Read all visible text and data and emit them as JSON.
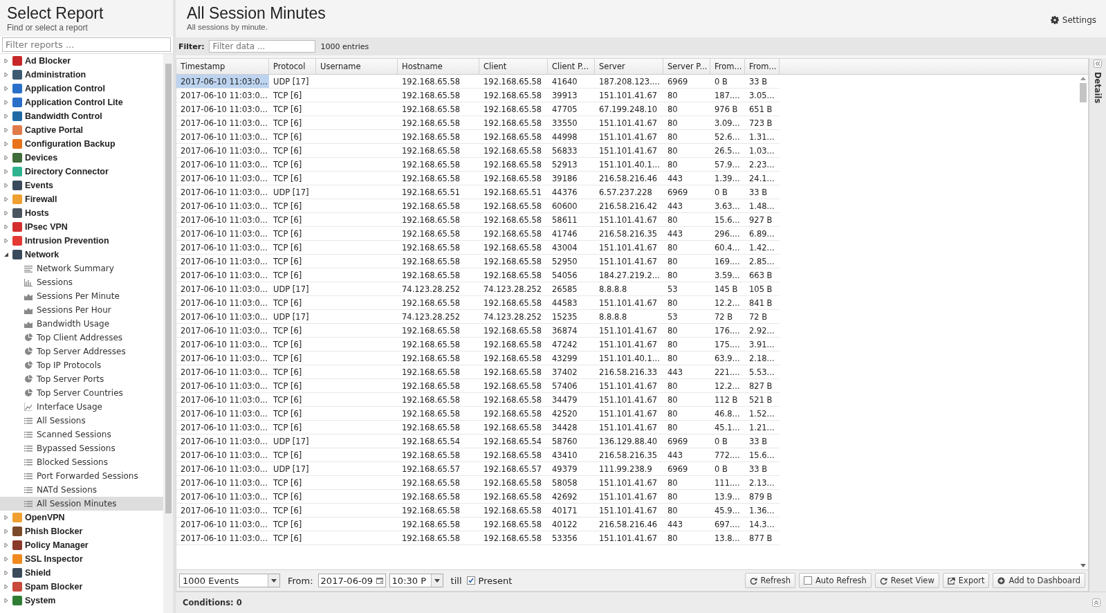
{
  "sidebar": {
    "title": "Select Report",
    "subtitle": "Find or select a report",
    "search": {
      "placeholder": "Filter reports ..."
    },
    "items": [
      {
        "label": "Ad Blocker",
        "color": "#c62828",
        "expanded": false
      },
      {
        "label": "Administration",
        "color": "#3d5a73",
        "expanded": false
      },
      {
        "label": "Application Control",
        "color": "#2a6fc9",
        "expanded": false
      },
      {
        "label": "Application Control Lite",
        "color": "#2a6fc8",
        "expanded": false
      },
      {
        "label": "Bandwidth Control",
        "color": "#1f6aa5",
        "expanded": false
      },
      {
        "label": "Captive Portal",
        "color": "#e07b4a",
        "expanded": false
      },
      {
        "label": "Configuration Backup",
        "color": "#e8731a",
        "expanded": false
      },
      {
        "label": "Devices",
        "color": "#3f6d3a",
        "expanded": false
      },
      {
        "label": "Directory Connector",
        "color": "#2fb38e",
        "expanded": false
      },
      {
        "label": "Events",
        "color": "#3a4a5c",
        "expanded": false
      },
      {
        "label": "Firewall",
        "color": "#f0a030",
        "expanded": false
      },
      {
        "label": "Hosts",
        "color": "#4a5560",
        "expanded": false
      },
      {
        "label": "IPsec VPN",
        "color": "#d32f2f",
        "expanded": false
      },
      {
        "label": "Intrusion Prevention",
        "color": "#e53935",
        "expanded": false
      },
      {
        "label": "Network",
        "color": "#3a4a5d",
        "expanded": true,
        "children": [
          {
            "label": "Network Summary",
            "kind": "text",
            "selected": false
          },
          {
            "label": "Sessions",
            "kind": "bars",
            "selected": false
          },
          {
            "label": "Sessions Per Minute",
            "kind": "area",
            "selected": false
          },
          {
            "label": "Sessions Per Hour",
            "kind": "area",
            "selected": false
          },
          {
            "label": "Bandwidth Usage",
            "kind": "area",
            "selected": false
          },
          {
            "label": "Top Client Addresses",
            "kind": "pie",
            "selected": false
          },
          {
            "label": "Top Server Addresses",
            "kind": "pie",
            "selected": false
          },
          {
            "label": "Top IP Protocols",
            "kind": "pie",
            "selected": false
          },
          {
            "label": "Top Server Ports",
            "kind": "pie",
            "selected": false
          },
          {
            "label": "Top Server Countries",
            "kind": "pie",
            "selected": false
          },
          {
            "label": "Interface Usage",
            "kind": "line",
            "selected": false
          },
          {
            "label": "All Sessions",
            "kind": "list",
            "selected": false
          },
          {
            "label": "Scanned Sessions",
            "kind": "list",
            "selected": false
          },
          {
            "label": "Bypassed Sessions",
            "kind": "list",
            "selected": false
          },
          {
            "label": "Blocked Sessions",
            "kind": "list",
            "selected": false
          },
          {
            "label": "Port Forwarded Sessions",
            "kind": "list",
            "selected": false
          },
          {
            "label": "NATd Sessions",
            "kind": "list",
            "selected": false
          },
          {
            "label": "All Session Minutes",
            "kind": "list",
            "selected": true
          }
        ]
      },
      {
        "label": "OpenVPN",
        "color": "#f0a031",
        "expanded": false
      },
      {
        "label": "Phish Blocker",
        "color": "#7a4a2a",
        "expanded": false
      },
      {
        "label": "Policy Manager",
        "color": "#8a3a2a",
        "expanded": false
      },
      {
        "label": "SSL Inspector",
        "color": "#f08a20",
        "expanded": false
      },
      {
        "label": "Shield",
        "color": "#3a4a5b",
        "expanded": false
      },
      {
        "label": "Spam Blocker",
        "color": "#c84a3a",
        "expanded": false
      },
      {
        "label": "System",
        "color": "#2e7d32",
        "expanded": false
      }
    ]
  },
  "report": {
    "title": "All Session Minutes",
    "subtitle": "All sessions by minute.",
    "settings": "Settings"
  },
  "filter": {
    "label": "Filter:",
    "placeholder": "Filter data ...",
    "count": "1000 entries"
  },
  "table": {
    "columns": [
      "Timestamp",
      "Protocol",
      "Username",
      "Hostname",
      "Client",
      "Client P...",
      "Server",
      "Server P...",
      "From...",
      "From..."
    ],
    "rows": [
      {
        "selected": true,
        "timestamp": "2017-06-10 11:03:0...",
        "protocol": "UDP [17]",
        "hostname": "192.168.65.58",
        "client": "192.168.65.58",
        "client_port": "41640",
        "server": "187.208.123....",
        "server_port": "6969",
        "from_1": "0 B",
        "from_2": "33 B"
      },
      {
        "selected": false,
        "timestamp": "2017-06-10 11:03:0...",
        "protocol": "TCP [6]",
        "hostname": "192.168.65.58",
        "client": "192.168.65.58",
        "client_port": "39913",
        "server": "151.101.41.67",
        "server_port": "80",
        "from_1": "187....",
        "from_2": "3.05..."
      },
      {
        "selected": false,
        "timestamp": "2017-06-10 11:03:0...",
        "protocol": "TCP [6]",
        "hostname": "192.168.65.58",
        "client": "192.168.65.58",
        "client_port": "47705",
        "server": "67.199.248.10",
        "server_port": "80",
        "from_1": "976 B",
        "from_2": "651 B"
      },
      {
        "selected": false,
        "timestamp": "2017-06-10 11:03:0...",
        "protocol": "TCP [6]",
        "hostname": "192.168.65.58",
        "client": "192.168.65.58",
        "client_port": "33550",
        "server": "151.101.41.67",
        "server_port": "80",
        "from_1": "3.09...",
        "from_2": "723 B"
      },
      {
        "selected": false,
        "timestamp": "2017-06-10 11:03:0...",
        "protocol": "TCP [6]",
        "hostname": "192.168.65.58",
        "client": "192.168.65.58",
        "client_port": "44998",
        "server": "151.101.41.67",
        "server_port": "80",
        "from_1": "52.6...",
        "from_2": "1.31..."
      },
      {
        "selected": false,
        "timestamp": "2017-06-10 11:03:0...",
        "protocol": "TCP [6]",
        "hostname": "192.168.65.58",
        "client": "192.168.65.58",
        "client_port": "56833",
        "server": "151.101.41.67",
        "server_port": "80",
        "from_1": "26.5...",
        "from_2": "1.03..."
      },
      {
        "selected": false,
        "timestamp": "2017-06-10 11:03:0...",
        "protocol": "TCP [6]",
        "hostname": "192.168.65.58",
        "client": "192.168.65.58",
        "client_port": "52913",
        "server": "151.101.40.1...",
        "server_port": "80",
        "from_1": "57.9...",
        "from_2": "2.23..."
      },
      {
        "selected": false,
        "timestamp": "2017-06-10 11:03:0...",
        "protocol": "TCP [6]",
        "hostname": "192.168.65.58",
        "client": "192.168.65.58",
        "client_port": "39186",
        "server": "216.58.216.46",
        "server_port": "443",
        "from_1": "1.39...",
        "from_2": "24.1..."
      },
      {
        "selected": false,
        "timestamp": "2017-06-10 11:03:0...",
        "protocol": "UDP [17]",
        "hostname": "192.168.65.51",
        "client": "192.168.65.51",
        "client_port": "44376",
        "server": "6.57.237.228",
        "server_port": "6969",
        "from_1": "0 B",
        "from_2": "33 B"
      },
      {
        "selected": false,
        "timestamp": "2017-06-10 11:03:0...",
        "protocol": "TCP [6]",
        "hostname": "192.168.65.58",
        "client": "192.168.65.58",
        "client_port": "60600",
        "server": "216.58.216.42",
        "server_port": "443",
        "from_1": "3.63...",
        "from_2": "1.48..."
      },
      {
        "selected": false,
        "timestamp": "2017-06-10 11:03:0...",
        "protocol": "TCP [6]",
        "hostname": "192.168.65.58",
        "client": "192.168.65.58",
        "client_port": "58611",
        "server": "151.101.41.67",
        "server_port": "80",
        "from_1": "15.6...",
        "from_2": "927 B"
      },
      {
        "selected": false,
        "timestamp": "2017-06-10 11:03:0...",
        "protocol": "TCP [6]",
        "hostname": "192.168.65.58",
        "client": "192.168.65.58",
        "client_port": "41746",
        "server": "216.58.216.35",
        "server_port": "443",
        "from_1": "296....",
        "from_2": "6.89..."
      },
      {
        "selected": false,
        "timestamp": "2017-06-10 11:03:0...",
        "protocol": "TCP [6]",
        "hostname": "192.168.65.58",
        "client": "192.168.65.58",
        "client_port": "43004",
        "server": "151.101.41.67",
        "server_port": "80",
        "from_1": "60.4...",
        "from_2": "1.42..."
      },
      {
        "selected": false,
        "timestamp": "2017-06-10 11:03:0...",
        "protocol": "TCP [6]",
        "hostname": "192.168.65.58",
        "client": "192.168.65.58",
        "client_port": "52950",
        "server": "151.101.41.67",
        "server_port": "80",
        "from_1": "169....",
        "from_2": "2.85..."
      },
      {
        "selected": false,
        "timestamp": "2017-06-10 11:03:0...",
        "protocol": "TCP [6]",
        "hostname": "192.168.65.58",
        "client": "192.168.65.58",
        "client_port": "54056",
        "server": "184.27.219.2...",
        "server_port": "80",
        "from_1": "3.59...",
        "from_2": "663 B"
      },
      {
        "selected": false,
        "timestamp": "2017-06-10 11:03:0...",
        "protocol": "UDP [17]",
        "hostname": "74.123.28.252",
        "client": "74.123.28.252",
        "client_port": "26585",
        "server": "8.8.8.8",
        "server_port": "53",
        "from_1": "145 B",
        "from_2": "105 B"
      },
      {
        "selected": false,
        "timestamp": "2017-06-10 11:03:0...",
        "protocol": "TCP [6]",
        "hostname": "192.168.65.58",
        "client": "192.168.65.58",
        "client_port": "44583",
        "server": "151.101.41.67",
        "server_port": "80",
        "from_1": "12.2...",
        "from_2": "841 B"
      },
      {
        "selected": false,
        "timestamp": "2017-06-10 11:03:0...",
        "protocol": "UDP [17]",
        "hostname": "74.123.28.252",
        "client": "74.123.28.252",
        "client_port": "15235",
        "server": "8.8.8.8",
        "server_port": "53",
        "from_1": "72 B",
        "from_2": "72 B"
      },
      {
        "selected": false,
        "timestamp": "2017-06-10 11:03:0...",
        "protocol": "TCP [6]",
        "hostname": "192.168.65.58",
        "client": "192.168.65.58",
        "client_port": "36874",
        "server": "151.101.41.67",
        "server_port": "80",
        "from_1": "176....",
        "from_2": "2.92..."
      },
      {
        "selected": false,
        "timestamp": "2017-06-10 11:03:0...",
        "protocol": "TCP [6]",
        "hostname": "192.168.65.58",
        "client": "192.168.65.58",
        "client_port": "47242",
        "server": "151.101.41.67",
        "server_port": "80",
        "from_1": "175....",
        "from_2": "3.91..."
      },
      {
        "selected": false,
        "timestamp": "2017-06-10 11:03:0...",
        "protocol": "TCP [6]",
        "hostname": "192.168.65.58",
        "client": "192.168.65.58",
        "client_port": "43299",
        "server": "151.101.40.1...",
        "server_port": "80",
        "from_1": "63.9...",
        "from_2": "2.18..."
      },
      {
        "selected": false,
        "timestamp": "2017-06-10 11:03:0...",
        "protocol": "TCP [6]",
        "hostname": "192.168.65.58",
        "client": "192.168.65.58",
        "client_port": "37402",
        "server": "216.58.216.33",
        "server_port": "443",
        "from_1": "221....",
        "from_2": "5.53..."
      },
      {
        "selected": false,
        "timestamp": "2017-06-10 11:03:0...",
        "protocol": "TCP [6]",
        "hostname": "192.168.65.58",
        "client": "192.168.65.58",
        "client_port": "57406",
        "server": "151.101.41.67",
        "server_port": "80",
        "from_1": "12.2...",
        "from_2": "827 B"
      },
      {
        "selected": false,
        "timestamp": "2017-06-10 11:03:0...",
        "protocol": "TCP [6]",
        "hostname": "192.168.65.58",
        "client": "192.168.65.58",
        "client_port": "34479",
        "server": "151.101.41.67",
        "server_port": "80",
        "from_1": "112 B",
        "from_2": "521 B"
      },
      {
        "selected": false,
        "timestamp": "2017-06-10 11:03:0...",
        "protocol": "TCP [6]",
        "hostname": "192.168.65.58",
        "client": "192.168.65.58",
        "client_port": "42520",
        "server": "151.101.41.67",
        "server_port": "80",
        "from_1": "46.8...",
        "from_2": "1.52..."
      },
      {
        "selected": false,
        "timestamp": "2017-06-10 11:03:0...",
        "protocol": "TCP [6]",
        "hostname": "192.168.65.58",
        "client": "192.168.65.58",
        "client_port": "34428",
        "server": "151.101.41.67",
        "server_port": "80",
        "from_1": "45.1...",
        "from_2": "1.21..."
      },
      {
        "selected": false,
        "timestamp": "2017-06-10 11:03:0...",
        "protocol": "UDP [17]",
        "hostname": "192.168.65.54",
        "client": "192.168.65.54",
        "client_port": "58760",
        "server": "136.129.88.40",
        "server_port": "6969",
        "from_1": "0 B",
        "from_2": "33 B"
      },
      {
        "selected": false,
        "timestamp": "2017-06-10 11:03:0...",
        "protocol": "TCP [6]",
        "hostname": "192.168.65.58",
        "client": "192.168.65.58",
        "client_port": "43410",
        "server": "216.58.216.35",
        "server_port": "443",
        "from_1": "772....",
        "from_2": "15.6..."
      },
      {
        "selected": false,
        "timestamp": "2017-06-10 11:03:0...",
        "protocol": "UDP [17]",
        "hostname": "192.168.65.57",
        "client": "192.168.65.57",
        "client_port": "49379",
        "server": "111.99.238.9",
        "server_port": "6969",
        "from_1": "0 B",
        "from_2": "33 B"
      },
      {
        "selected": false,
        "timestamp": "2017-06-10 11:03:0...",
        "protocol": "TCP [6]",
        "hostname": "192.168.65.58",
        "client": "192.168.65.58",
        "client_port": "58058",
        "server": "151.101.41.67",
        "server_port": "80",
        "from_1": "111....",
        "from_2": "2.13..."
      },
      {
        "selected": false,
        "timestamp": "2017-06-10 11:03:0...",
        "protocol": "TCP [6]",
        "hostname": "192.168.65.58",
        "client": "192.168.65.58",
        "client_port": "42692",
        "server": "151.101.41.67",
        "server_port": "80",
        "from_1": "13.9...",
        "from_2": "879 B"
      },
      {
        "selected": false,
        "timestamp": "2017-06-10 11:03:0...",
        "protocol": "TCP [6]",
        "hostname": "192.168.65.58",
        "client": "192.168.65.58",
        "client_port": "40171",
        "server": "151.101.41.67",
        "server_port": "80",
        "from_1": "45.9...",
        "from_2": "1.36..."
      },
      {
        "selected": false,
        "timestamp": "2017-06-10 11:03:0...",
        "protocol": "TCP [6]",
        "hostname": "192.168.65.58",
        "client": "192.168.65.58",
        "client_port": "40122",
        "server": "216.58.216.46",
        "server_port": "443",
        "from_1": "697....",
        "from_2": "14.3..."
      },
      {
        "selected": false,
        "timestamp": "2017-06-10 11:03:0...",
        "protocol": "TCP [6]",
        "hostname": "192.168.65.58",
        "client": "192.168.65.58",
        "client_port": "53356",
        "server": "151.101.41.67",
        "server_port": "80",
        "from_1": "13.8...",
        "from_2": "877 B"
      }
    ]
  },
  "toolbar": {
    "limit": "1000 Events",
    "from_label": "From:",
    "date": "2017-06-09",
    "time": "10:30 P",
    "till_label": "till",
    "present": {
      "label": "Present",
      "checked": true
    },
    "refresh": "Refresh",
    "auto_refresh": {
      "label": "Auto Refresh",
      "checked": false
    },
    "reset": "Reset View",
    "export": "Export",
    "dashboard": "Add to Dashboard"
  },
  "conditions": "Conditions: 0",
  "details": "Details"
}
